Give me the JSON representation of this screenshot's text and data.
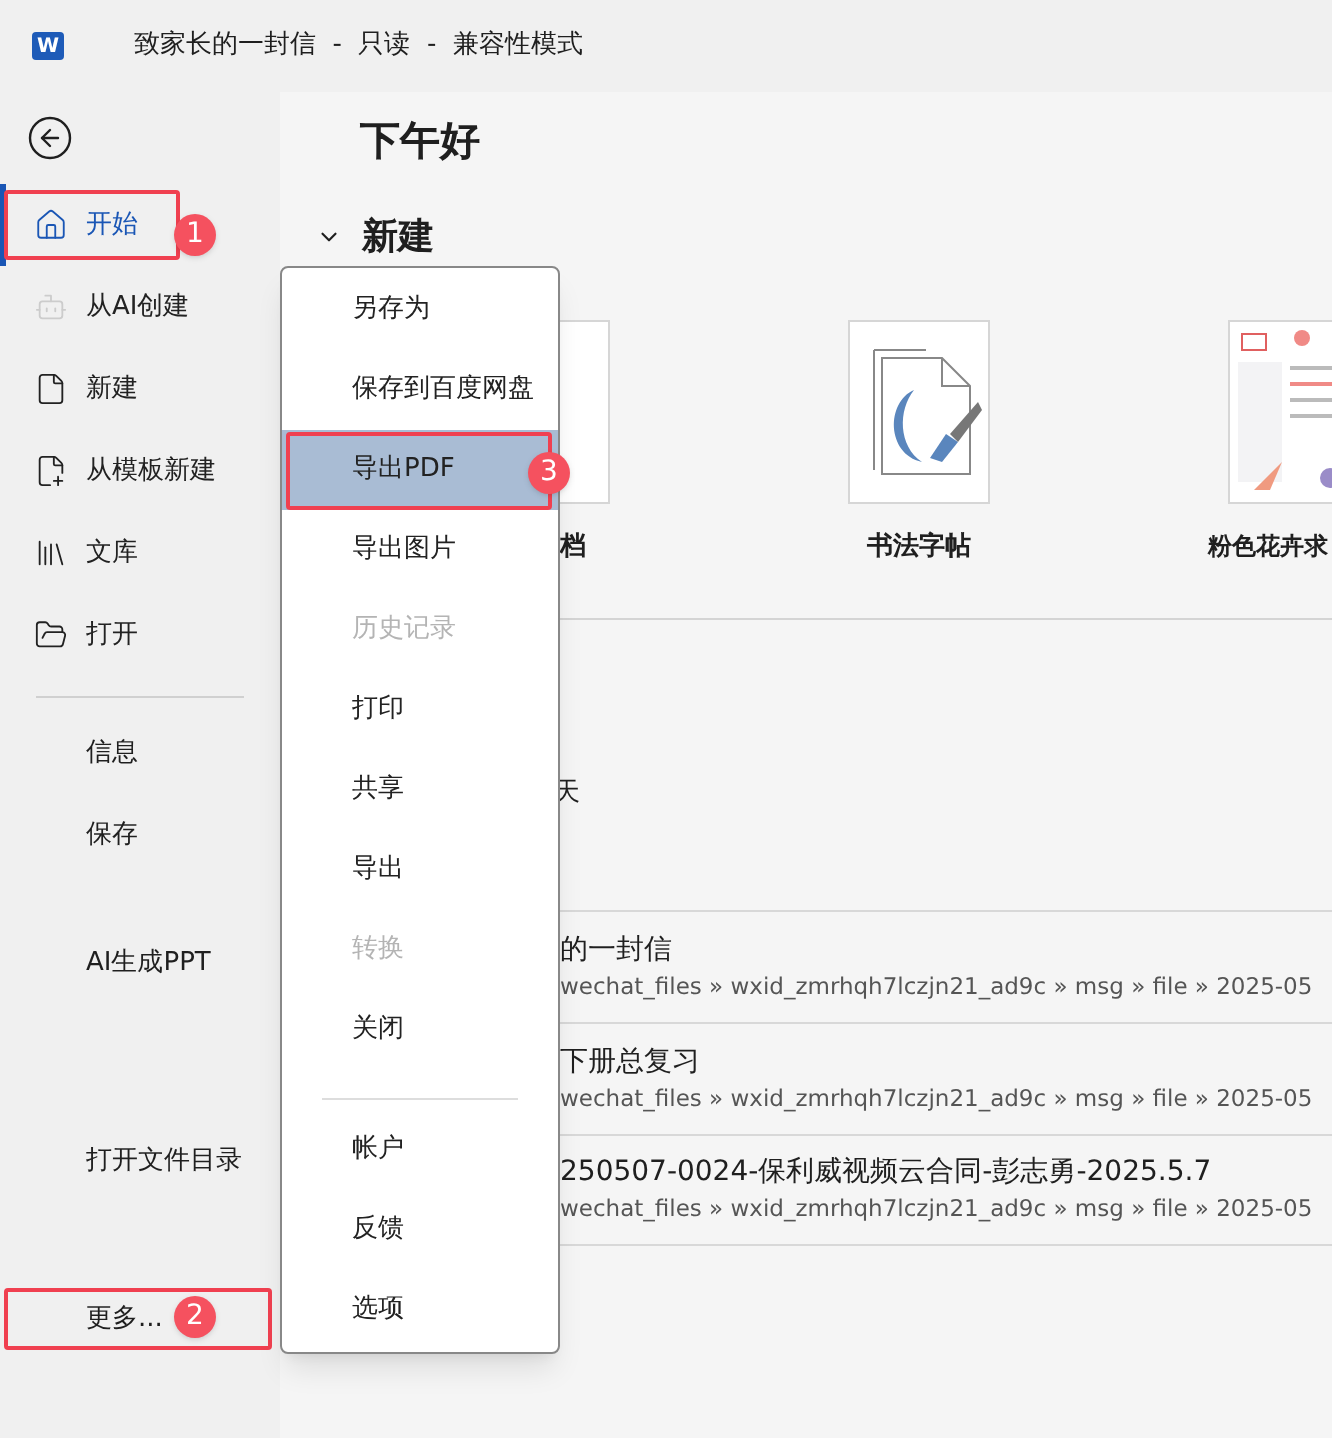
{
  "title_bar": {
    "logo_letter": "W",
    "title": "致家长的一封信  -  只读  -  兼容性模式"
  },
  "sidebar": {
    "nav_items": [
      {
        "label": "开始",
        "kind": "home",
        "selected": true,
        "callout": "1"
      },
      {
        "label": "从AI创建",
        "kind": "ai",
        "selected": false
      },
      {
        "label": "新建",
        "kind": "file",
        "selected": false
      },
      {
        "label": "从模板新建",
        "kind": "template",
        "selected": false
      },
      {
        "label": "文库",
        "kind": "library",
        "selected": false
      },
      {
        "label": "打开",
        "kind": "folder",
        "selected": false
      }
    ],
    "action_items": [
      {
        "label": "信息"
      },
      {
        "label": "保存"
      },
      {
        "label": "AI生成PPT"
      },
      {
        "label": "打开文件目录"
      }
    ],
    "more_item": {
      "label": "更多...",
      "callout": "2"
    }
  },
  "main": {
    "greeting": "下午好",
    "new_section": {
      "title": "新建",
      "expanded": true
    },
    "templates": [
      {
        "label": "档",
        "kind": "blank"
      },
      {
        "label": "书法字帖",
        "kind": "calligraphy"
      },
      {
        "label": "粉色花卉求",
        "kind": "floral"
      }
    ],
    "recent_group": "天",
    "recent_files": [
      {
        "title": "的一封信",
        "path": "wechat_files » wxid_zmrhqh7lczjn21_ad9c » msg » file » 2025-05"
      },
      {
        "title": "下册总复习",
        "path": "wechat_files » wxid_zmrhqh7lczjn21_ad9c » msg » file » 2025-05"
      },
      {
        "title": "250507-0024-保利威视频云合同-彭志勇-2025.5.7",
        "path": "wechat_files » wxid_zmrhqh7lczjn21_ad9c » msg » file » 2025-05"
      }
    ]
  },
  "menu": {
    "groups": [
      [
        {
          "label": "另存为",
          "disabled": false,
          "selected": false
        },
        {
          "label": "保存到百度网盘",
          "disabled": false,
          "selected": false
        },
        {
          "label": "导出PDF",
          "disabled": false,
          "selected": true,
          "callout": "3"
        },
        {
          "label": "导出图片",
          "disabled": false,
          "selected": false
        },
        {
          "label": "历史记录",
          "disabled": true,
          "selected": false
        },
        {
          "label": "打印",
          "disabled": false,
          "selected": false
        },
        {
          "label": "共享",
          "disabled": false,
          "selected": false
        },
        {
          "label": "导出",
          "disabled": false,
          "selected": false
        },
        {
          "label": "转换",
          "disabled": true,
          "selected": false
        },
        {
          "label": "关闭",
          "disabled": false,
          "selected": false
        }
      ],
      [
        {
          "label": "帐户",
          "disabled": false,
          "selected": false
        },
        {
          "label": "反馈",
          "disabled": false,
          "selected": false
        },
        {
          "label": "选项",
          "disabled": false,
          "selected": false
        }
      ]
    ]
  }
}
